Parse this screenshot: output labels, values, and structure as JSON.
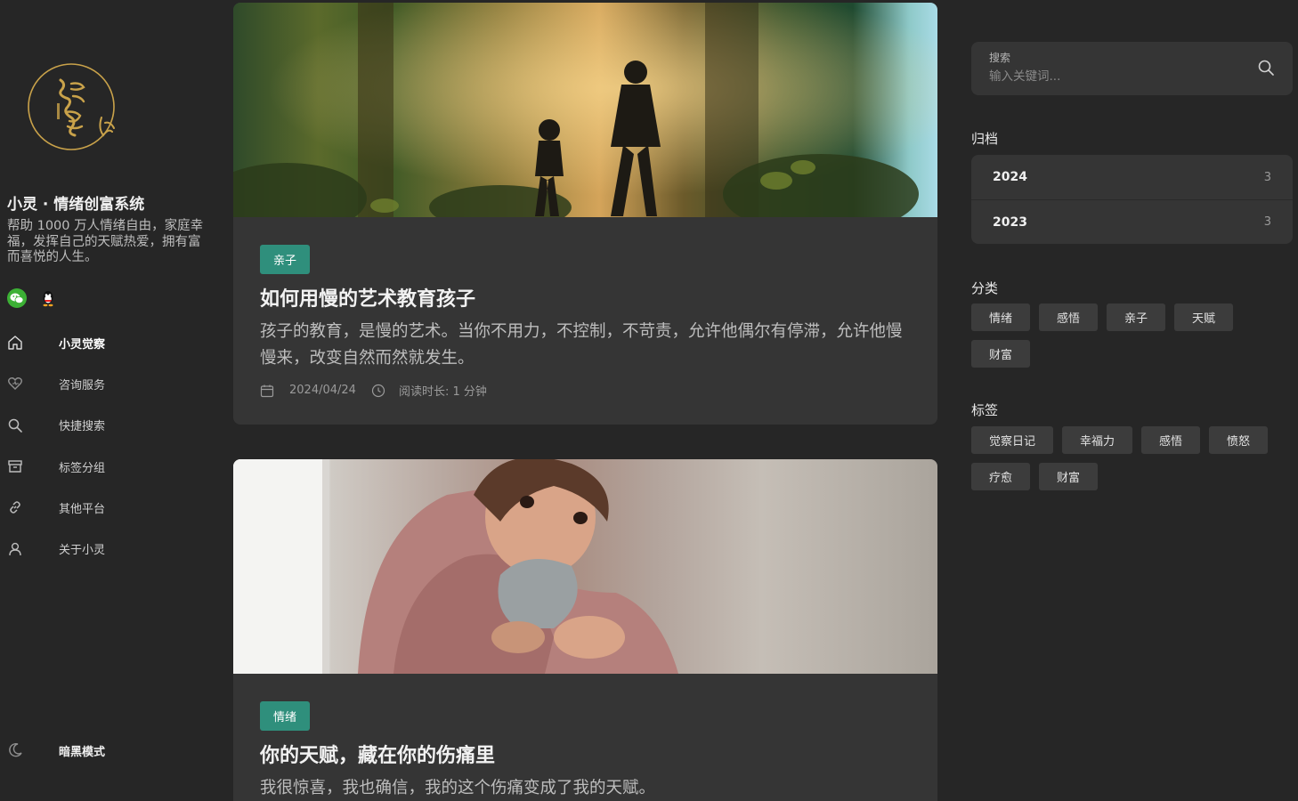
{
  "site": {
    "title": "小灵 · 情绪创富系统",
    "description": "帮助 1000 万人情绪自由，家庭幸福，发挥自己的天赋热爱，拥有富而喜悦的人生。"
  },
  "social": [
    {
      "name": "wechat-icon",
      "color": "#3cb035"
    },
    {
      "name": "qq-icon",
      "color": "#111111"
    }
  ],
  "nav": [
    {
      "label": "小灵觉察",
      "icon": "home-icon",
      "active": true
    },
    {
      "label": "咨询服务",
      "icon": "heart-icon"
    },
    {
      "label": "快捷搜索",
      "icon": "search-icon"
    },
    {
      "label": "标签分组",
      "icon": "archive-box-icon"
    },
    {
      "label": "其他平台",
      "icon": "link-icon"
    },
    {
      "label": "关于小灵",
      "icon": "user-icon"
    }
  ],
  "dark_mode": {
    "label": "暗黑模式",
    "icon": "moon-icon"
  },
  "posts": [
    {
      "category": "亲子",
      "title": "如何用慢的艺术教育孩子",
      "excerpt": "孩子的教育，是慢的艺术。当你不用力，不控制，不苛责，允许他偶尔有停滞，允许他慢慢来，改变自然而然就发生。",
      "date": "2024/04/24",
      "read_time": "阅读时长: 1 分钟"
    },
    {
      "category": "情绪",
      "title": "你的天赋，藏在你的伤痛里",
      "excerpt": "我很惊喜，我也确信，我的这个伤痛变成了我的天赋。"
    }
  ],
  "search": {
    "label": "搜索",
    "placeholder": "输入关键词..."
  },
  "archive": {
    "title": "归档",
    "items": [
      {
        "year": "2024",
        "count": "3"
      },
      {
        "year": "2023",
        "count": "3"
      }
    ]
  },
  "categories": {
    "title": "分类",
    "items": [
      "情绪",
      "感悟",
      "亲子",
      "天赋",
      "财富"
    ]
  },
  "tags": {
    "title": "标签",
    "items": [
      "觉察日记",
      "幸福力",
      "感悟",
      "愤怒",
      "疗愈",
      "财富"
    ]
  },
  "colors": {
    "background": "#262626",
    "card": "#353535",
    "accent": "#2f8f7c",
    "logo_gold": "#c9a24a"
  }
}
